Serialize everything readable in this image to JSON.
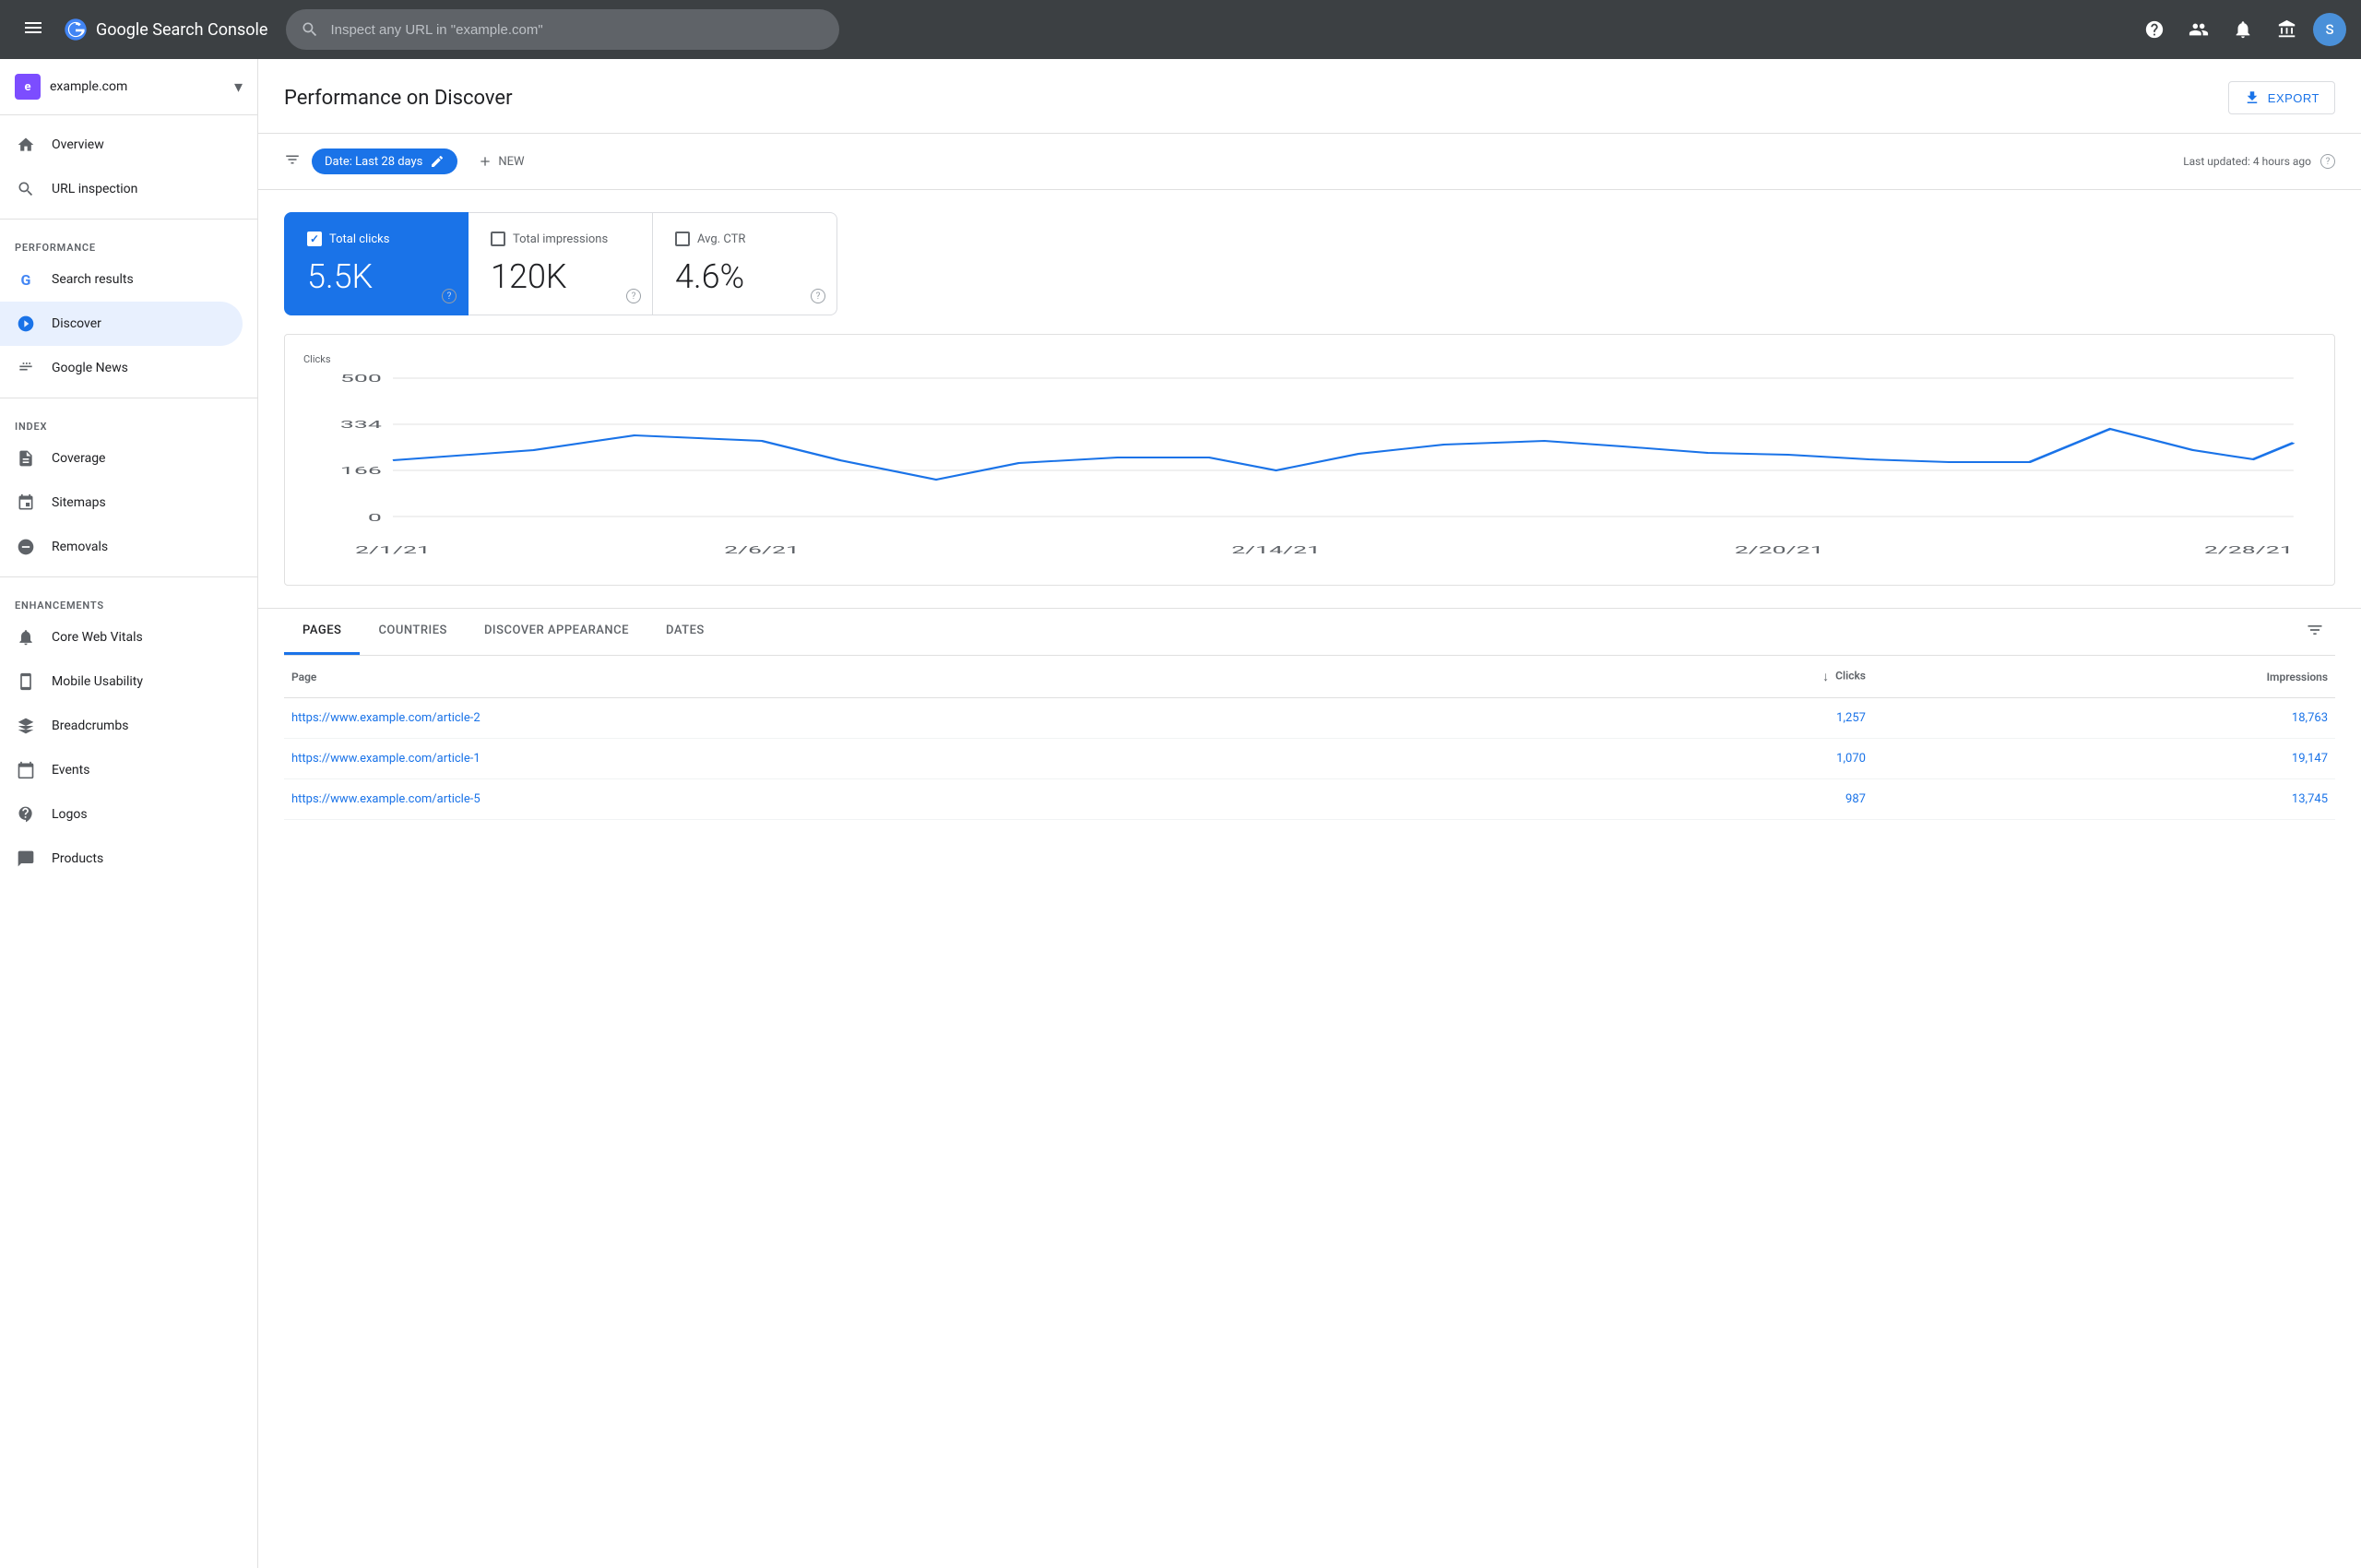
{
  "topnav": {
    "logo_text": "Google Search Console",
    "search_placeholder": "Inspect any URL in \"example.com\"",
    "avatar_letter": "S"
  },
  "sidebar": {
    "property_name": "example.com",
    "items": [
      {
        "id": "overview",
        "label": "Overview",
        "icon": "home"
      },
      {
        "id": "url-inspection",
        "label": "URL inspection",
        "icon": "search"
      }
    ],
    "sections": [
      {
        "label": "Performance",
        "items": [
          {
            "id": "search-results",
            "label": "Search results",
            "icon": "G"
          },
          {
            "id": "discover",
            "label": "Discover",
            "icon": "asterisk",
            "active": true
          },
          {
            "id": "google-news",
            "label": "Google News",
            "icon": "news"
          }
        ]
      },
      {
        "label": "Index",
        "items": [
          {
            "id": "coverage",
            "label": "Coverage",
            "icon": "file"
          },
          {
            "id": "sitemaps",
            "label": "Sitemaps",
            "icon": "sitemap"
          },
          {
            "id": "removals",
            "label": "Removals",
            "icon": "remove"
          }
        ]
      },
      {
        "label": "Enhancements",
        "items": [
          {
            "id": "core-web-vitals",
            "label": "Core Web Vitals",
            "icon": "vitals"
          },
          {
            "id": "mobile-usability",
            "label": "Mobile Usability",
            "icon": "mobile"
          },
          {
            "id": "breadcrumbs",
            "label": "Breadcrumbs",
            "icon": "breadcrumb"
          },
          {
            "id": "events",
            "label": "Events",
            "icon": "event"
          },
          {
            "id": "logos",
            "label": "Logos",
            "icon": "logo"
          },
          {
            "id": "products",
            "label": "Products",
            "icon": "product"
          }
        ]
      }
    ]
  },
  "main": {
    "title": "Performance on Discover",
    "export_label": "EXPORT",
    "filter": {
      "date_label": "Date: Last 28 days",
      "new_label": "NEW",
      "last_updated": "Last updated: 4 hours ago"
    },
    "metrics": [
      {
        "id": "total-clicks",
        "label": "Total clicks",
        "value": "5.5K",
        "active": true
      },
      {
        "id": "total-impressions",
        "label": "Total impressions",
        "value": "120K",
        "active": false
      },
      {
        "id": "avg-ctr",
        "label": "Avg. CTR",
        "value": "4.6%",
        "active": false
      }
    ],
    "chart": {
      "y_label": "Clicks",
      "y_ticks": [
        "500",
        "334",
        "166",
        "0"
      ],
      "x_ticks": [
        "2/1/21",
        "2/6/21",
        "2/14/21",
        "2/20/21",
        "2/28/21"
      ],
      "data_points": [
        {
          "x": 0,
          "y": 0.52
        },
        {
          "x": 0.07,
          "y": 0.58
        },
        {
          "x": 0.12,
          "y": 0.72
        },
        {
          "x": 0.18,
          "y": 0.68
        },
        {
          "x": 0.22,
          "y": 0.52
        },
        {
          "x": 0.27,
          "y": 0.38
        },
        {
          "x": 0.31,
          "y": 0.5
        },
        {
          "x": 0.36,
          "y": 0.53
        },
        {
          "x": 0.4,
          "y": 0.53
        },
        {
          "x": 0.43,
          "y": 0.45
        },
        {
          "x": 0.48,
          "y": 0.55
        },
        {
          "x": 0.52,
          "y": 0.62
        },
        {
          "x": 0.57,
          "y": 0.64
        },
        {
          "x": 0.6,
          "y": 0.6
        },
        {
          "x": 0.64,
          "y": 0.56
        },
        {
          "x": 0.68,
          "y": 0.55
        },
        {
          "x": 0.72,
          "y": 0.52
        },
        {
          "x": 0.76,
          "y": 0.5
        },
        {
          "x": 0.8,
          "y": 0.5
        },
        {
          "x": 0.84,
          "y": 0.78
        },
        {
          "x": 0.88,
          "y": 0.58
        },
        {
          "x": 0.91,
          "y": 0.52
        },
        {
          "x": 0.95,
          "y": 0.52
        },
        {
          "x": 1.0,
          "y": 0.65
        }
      ]
    },
    "tabs": [
      {
        "id": "pages",
        "label": "PAGES",
        "active": true
      },
      {
        "id": "countries",
        "label": "COUNTRIES",
        "active": false
      },
      {
        "id": "discover-appearance",
        "label": "DISCOVER APPEARANCE",
        "active": false
      },
      {
        "id": "dates",
        "label": "DATES",
        "active": false
      }
    ],
    "table": {
      "columns": [
        {
          "id": "page",
          "label": "Page",
          "align": "left"
        },
        {
          "id": "clicks",
          "label": "Clicks",
          "align": "right",
          "sortable": true
        },
        {
          "id": "impressions",
          "label": "Impressions",
          "align": "right"
        }
      ],
      "rows": [
        {
          "page": "https://www.example.com/article-2",
          "clicks": "1,257",
          "impressions": "18,763"
        },
        {
          "page": "https://www.example.com/article-1",
          "clicks": "1,070",
          "impressions": "19,147"
        },
        {
          "page": "https://www.example.com/article-5",
          "clicks": "987",
          "impressions": "13,745"
        }
      ]
    }
  }
}
